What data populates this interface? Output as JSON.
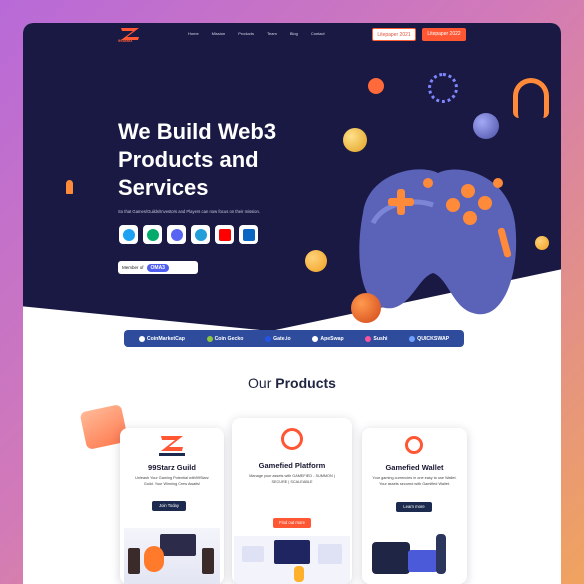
{
  "brand": {
    "logo_text": "99Starz"
  },
  "nav": {
    "links": [
      "Home",
      "Mission",
      "Products",
      "Team",
      "Blog",
      "Contact"
    ]
  },
  "wallpapers": {
    "wp2021": "Litepaper 2021",
    "wp2022": "Litepaper 2022"
  },
  "hero": {
    "headline_1": "We Build Web3",
    "headline_2": "Products and",
    "headline_3": "Services",
    "subline": "So that Games/Guilds/Investors and Players can now focus on their mission.",
    "member_label": "Member of",
    "member_logo": "OMA3"
  },
  "socials": [
    {
      "name": "twitter",
      "color": "#1da1f2"
    },
    {
      "name": "medium",
      "color": "#00ab6c"
    },
    {
      "name": "discord",
      "color": "#5865f2"
    },
    {
      "name": "telegram",
      "color": "#229ed9"
    },
    {
      "name": "youtube",
      "color": "#ff0000"
    },
    {
      "name": "linkedin",
      "color": "#0a66c2"
    }
  ],
  "partners": [
    "CoinMarketCap",
    "Coin Gecko",
    "Gate.io",
    "ApeSwap",
    "Sushi",
    "QUICKSWAP"
  ],
  "products_section": {
    "title_prefix": "Our",
    "title_bold": "Products"
  },
  "products": [
    {
      "title": "99Starz Guild",
      "desc": "Unleash Your Gaming Potential with99Starz Guild. Your Winning Crew Awaits!",
      "button": "Join Today",
      "btn_color": "#1b2a4e"
    },
    {
      "title": "Gamefied Platform",
      "desc": "Manage your assets with GAMEFIED - SUMMON | SECURE | SCALEABLE",
      "button": "Find out more",
      "btn_color": "#ff5634"
    },
    {
      "title": "Gamefied Wallet",
      "desc": "Your gaming currencies in one easy to use Wallet. Your assets secured with Gamified Wallet.",
      "button": "Learn more",
      "btn_color": "#1b2a4e"
    }
  ]
}
